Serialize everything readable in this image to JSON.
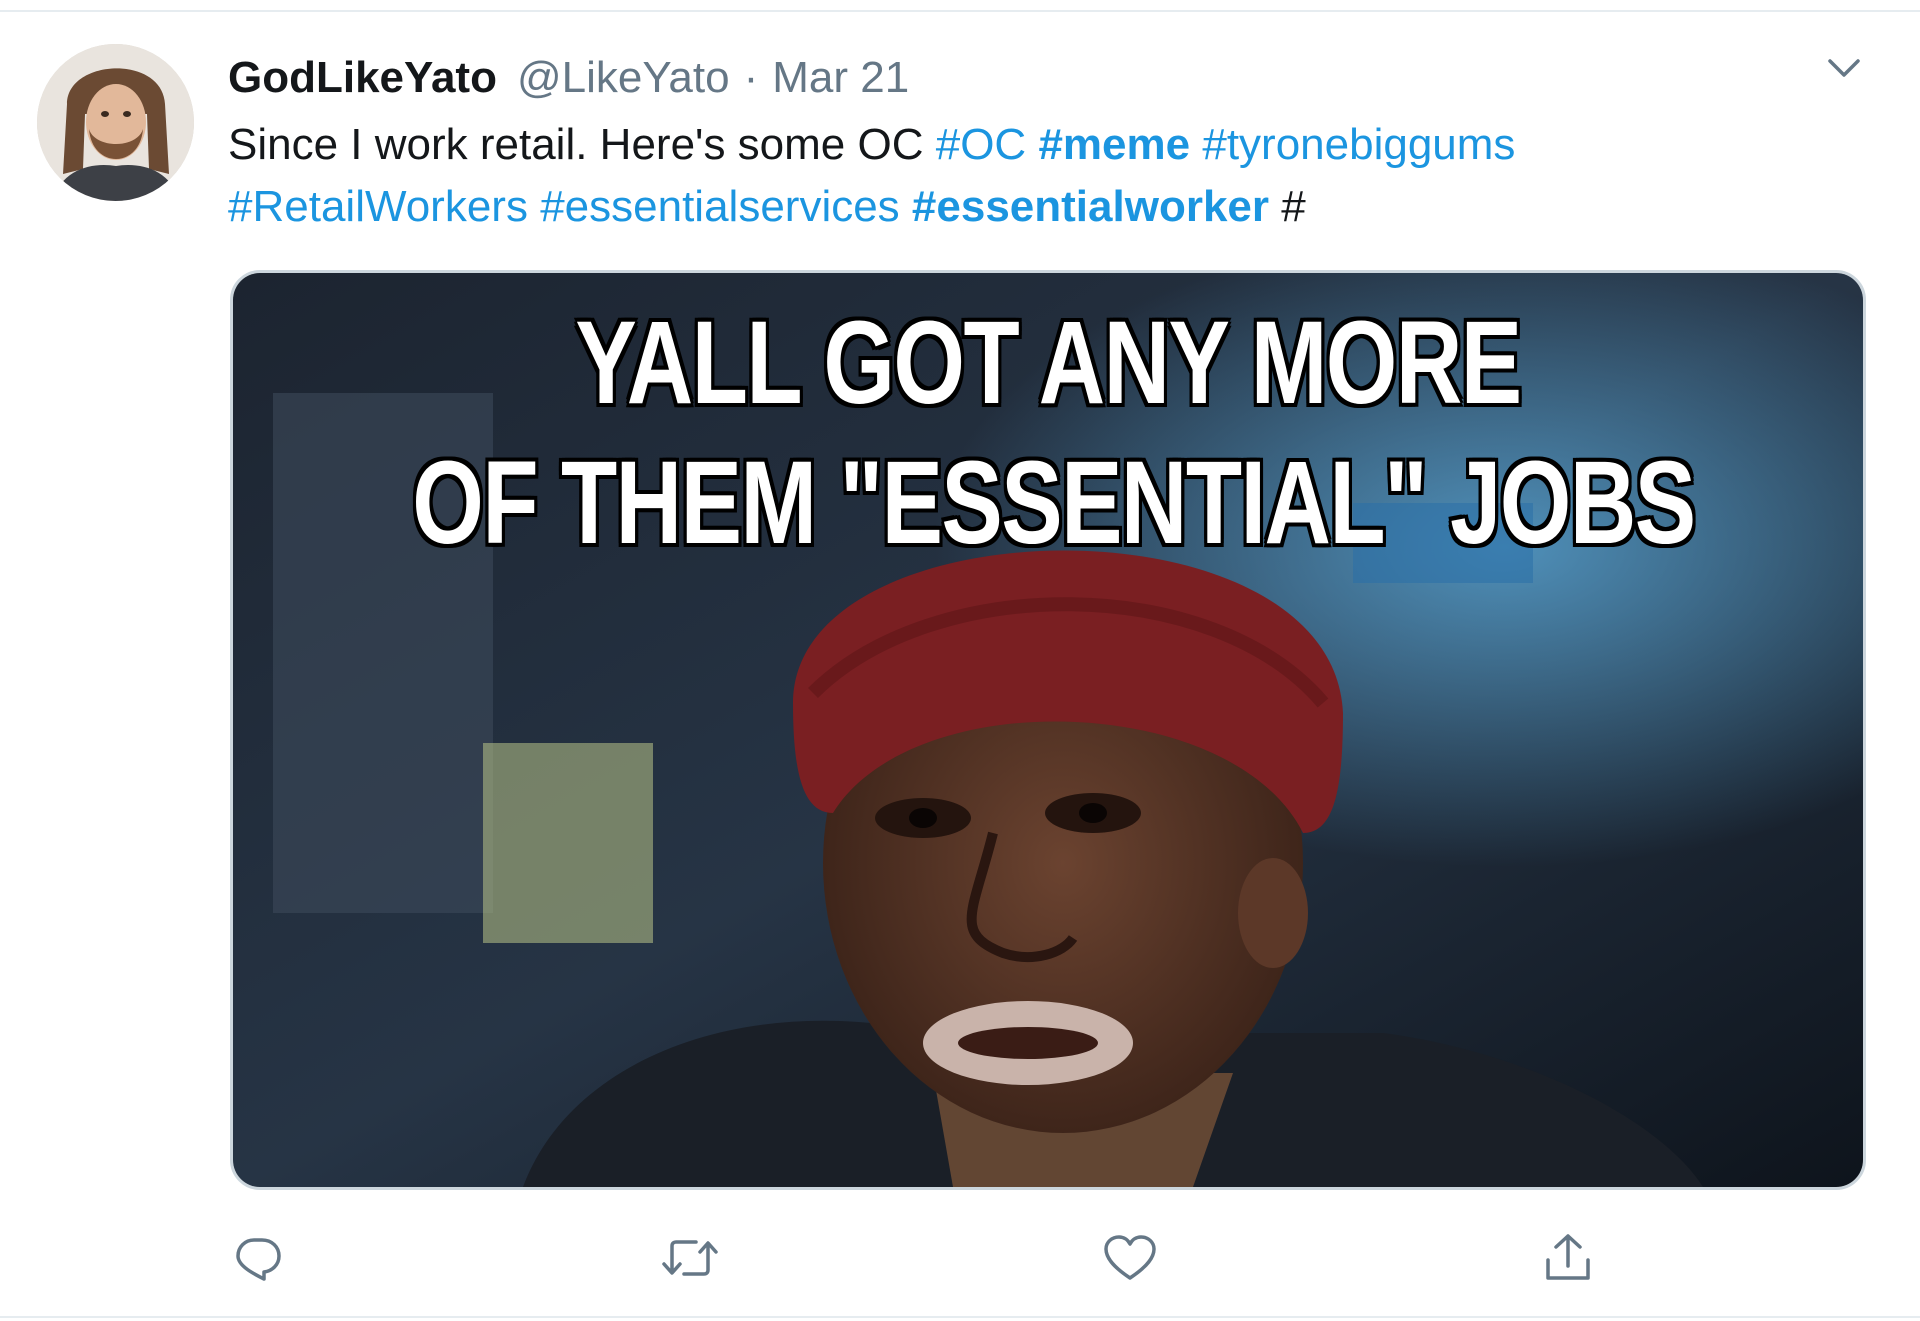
{
  "tweet": {
    "display_name": "GodLikeYato",
    "handle": "@LikeYato",
    "separator": "·",
    "timestamp": "Mar 21",
    "text_plain": "Since I work retail. Here's some OC",
    "hashtags": {
      "oc": "#OC",
      "meme": "#meme",
      "tyronebiggums": "#tyronebiggums",
      "retailworkers": "#RetailWorkers",
      "essentialservices": "#essentialservices",
      "essentialworker": "#essentialworker",
      "trailing": "#"
    }
  },
  "media": {
    "meme_line_1": "YALL GOT ANY MORE",
    "meme_line_2": "OF THEM \"ESSENTIAL\" JOBS"
  },
  "icons": {
    "caret": "chevron-down-icon",
    "reply": "reply-icon",
    "retweet": "retweet-icon",
    "like": "heart-icon",
    "share": "share-icon"
  },
  "colors": {
    "link": "#1b95e0",
    "text": "#14171a",
    "secondary": "#657786",
    "border": "#e6ecf0"
  }
}
